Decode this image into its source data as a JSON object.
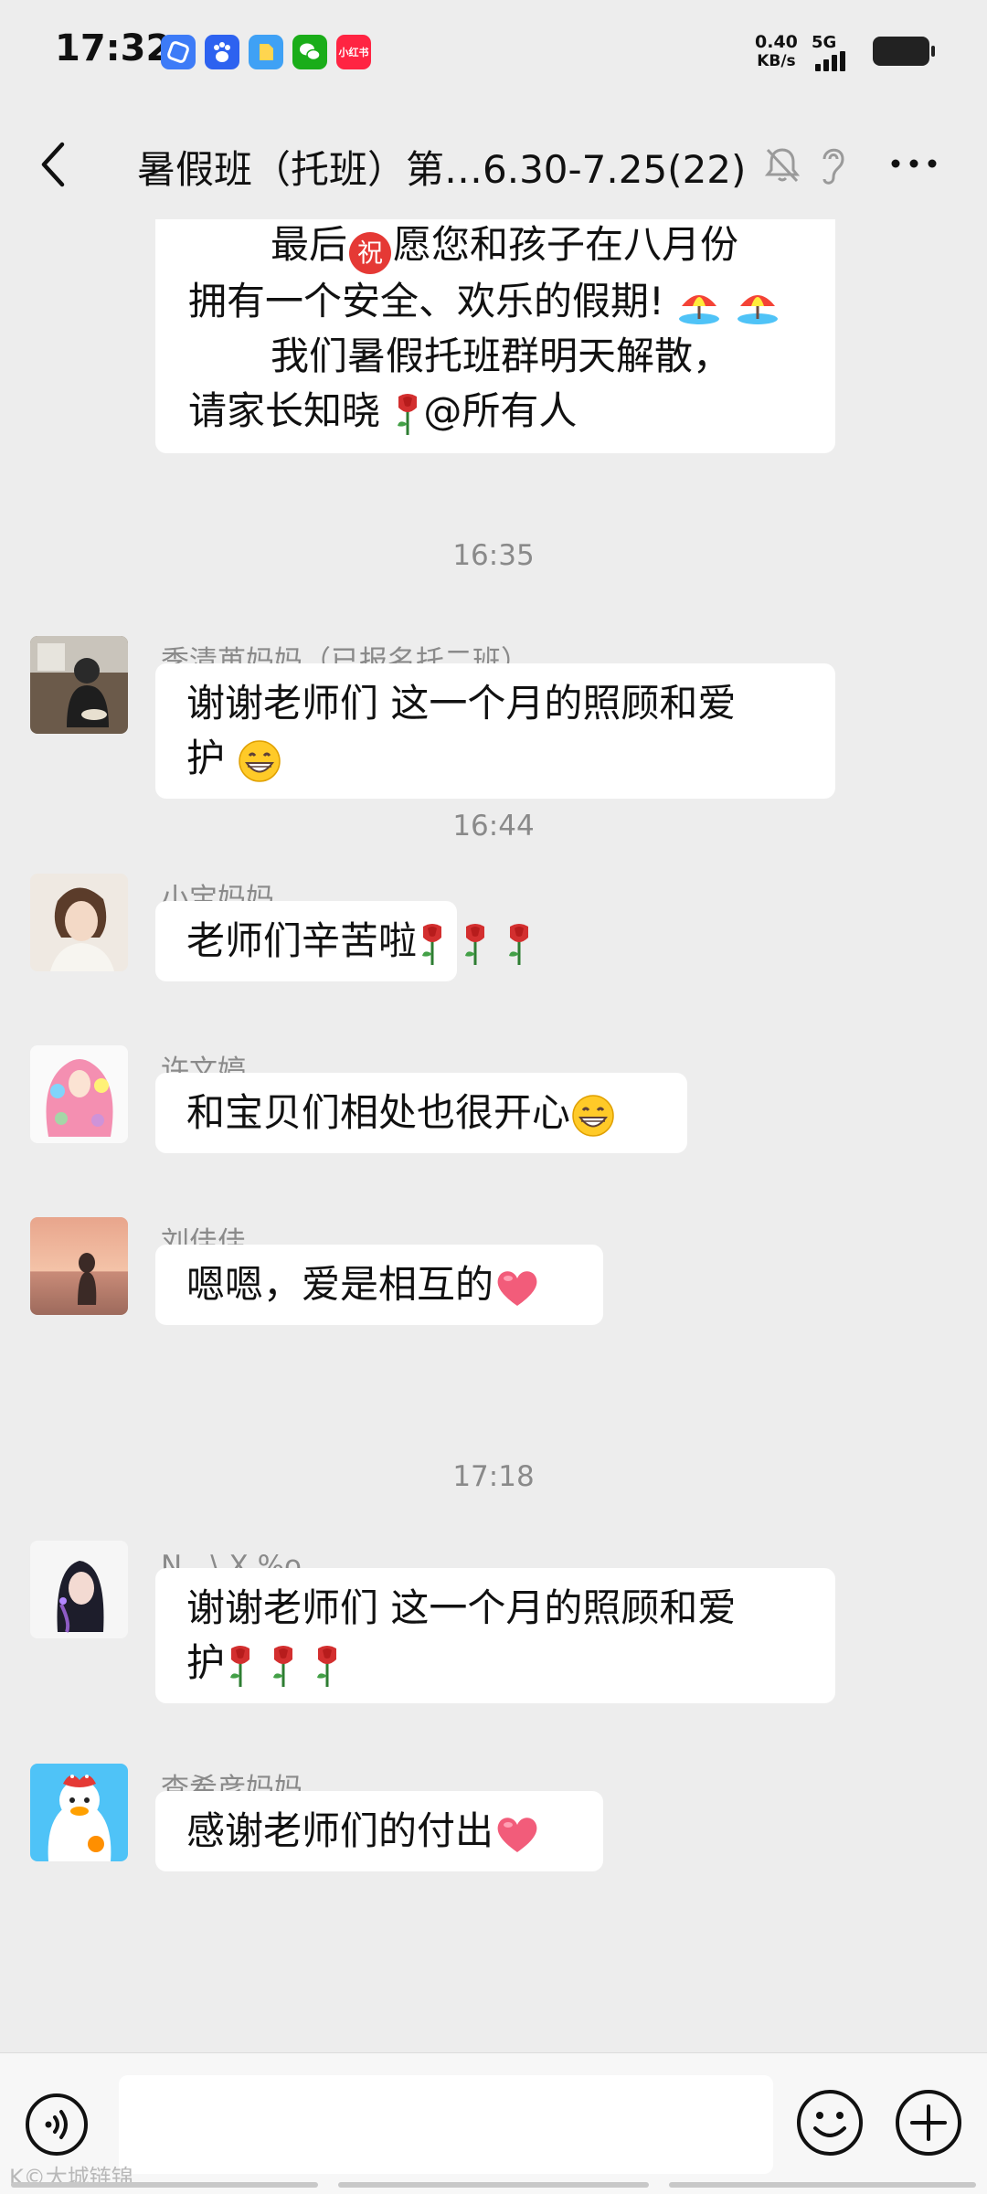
{
  "status_bar": {
    "time": "17:32",
    "net_speed_value": "0.40",
    "net_speed_unit": "KB/s",
    "network": "5G",
    "app_icons": [
      {
        "name": "browser-icon",
        "color": "#3D7BF7",
        "glyph": ""
      },
      {
        "name": "baidu-icon",
        "color": "#2D62F0",
        "glyph": ""
      },
      {
        "name": "files-icon",
        "color": "#3FA1F5",
        "glyph": ""
      },
      {
        "name": "wechat-icon",
        "color": "#1AAD19",
        "glyph": ""
      },
      {
        "name": "xiaohongshu-icon",
        "color": "#FF2442",
        "glyph": "小红书"
      }
    ]
  },
  "header": {
    "title": "暑假班（托班）第…6.30-7.25(22)"
  },
  "messages": {
    "first": {
      "line1_a": "最后",
      "line1_zhu": "祝",
      "line1_b": "愿您和孩子在八月份",
      "line2": "拥有一个安全、欢乐的假期!",
      "line3": "我们暑假托班群明天解散，",
      "line4": "请家长知晓",
      "line4_b": "@所有人"
    },
    "ts1": "16:35",
    "m1": {
      "sender": "季清苒妈妈（已报名托二班）",
      "line1": "谢谢老师们 这一个月的照顾和爱",
      "line2": "护"
    },
    "ts2": "16:44",
    "m2": {
      "sender": "小宝妈妈",
      "text": "老师们辛苦啦"
    },
    "m3": {
      "sender": "许文婷",
      "text": "和宝贝们相处也很开心"
    },
    "m4": {
      "sender": "刘佳佳",
      "text": "嗯嗯，爱是相互的"
    },
    "ts3": "17:18",
    "m5": {
      "sender": "N。\\ X %o",
      "line1": "谢谢老师们 这一个月的照顾和爱",
      "line2": "护"
    },
    "m6": {
      "sender": "查希彦妈妈",
      "text": "感谢老师们的付出"
    }
  },
  "input": {
    "placeholder": ""
  },
  "watermark": "K©大城链锦",
  "colors": {
    "background": "#EDEDED",
    "bubble": "#FFFFFF",
    "meta_text": "#8A8A8A",
    "heart": "#F25C7A",
    "rose": "#D32F2F"
  }
}
